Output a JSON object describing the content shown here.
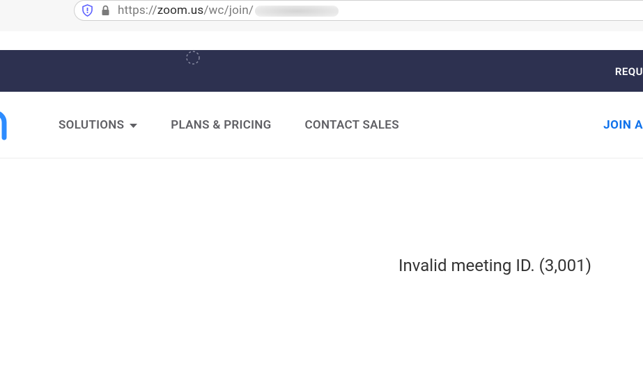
{
  "browser": {
    "url_prefix": "https://",
    "url_host": "zoom.us",
    "url_path": "/wc/join/"
  },
  "top_banner": {
    "right_label": "REQU"
  },
  "nav": {
    "solutions_label": "SOLUTIONS",
    "plans_label": "PLANS & PRICING",
    "contact_label": "CONTACT SALES",
    "join_label": "JOIN A"
  },
  "content": {
    "error_message": "Invalid meeting ID. (3,001)"
  }
}
